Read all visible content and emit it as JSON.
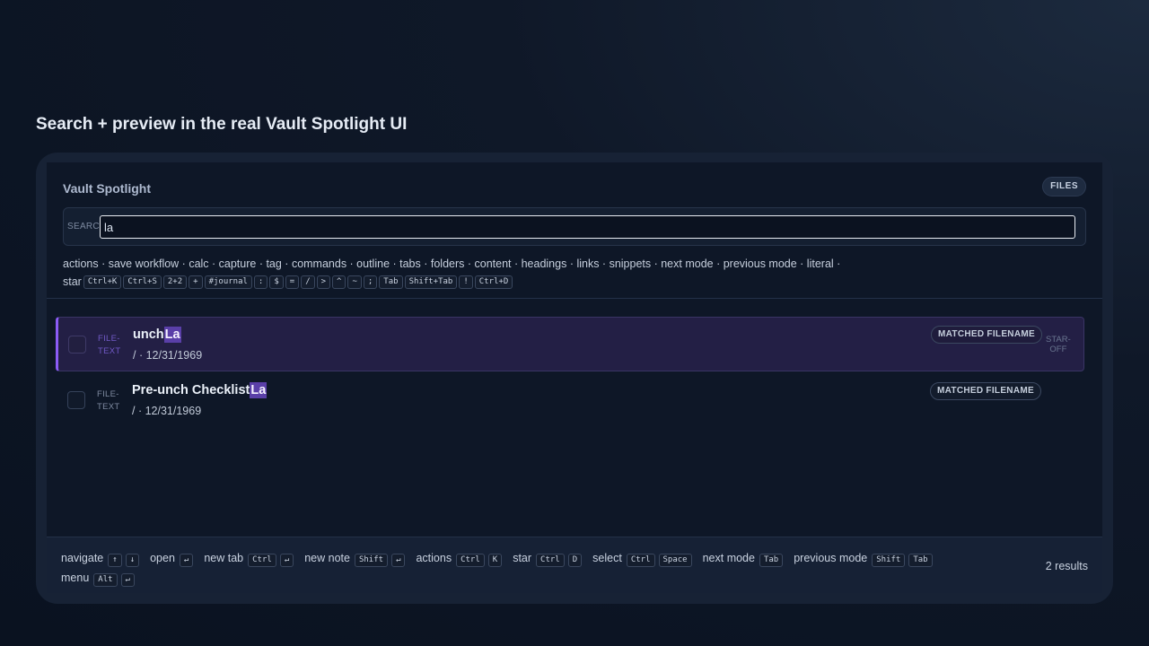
{
  "page": {
    "heading": "Search + preview in the real Vault Spotlight UI"
  },
  "header": {
    "title": "Vault Spotlight",
    "mode_badge": "FILES"
  },
  "search": {
    "label": "SEARCH",
    "value": "la",
    "placeholder": ""
  },
  "hints": {
    "line1": "actions · save workflow · calc · capture · tag · commands · outline · tabs · folders · content · headings · links · snippets · next mode · previous mode · literal ·",
    "line2_word": "star",
    "keys": [
      "Ctrl+K",
      "Ctrl+S",
      "2+2",
      "+",
      "#journal",
      ":",
      "$",
      "=",
      "/",
      ">",
      "^",
      "~",
      ";",
      "Tab",
      "Shift+Tab",
      "!",
      "Ctrl+D"
    ]
  },
  "results": [
    {
      "kind_line1": "FILE-",
      "kind_line2": "TEXT",
      "title_prefix": "unch",
      "title_match": "La",
      "meta": "/ · 12/31/1969",
      "badge": "MATCHED FILENAME",
      "star_line1": "STAR-",
      "star_line2": "OFF",
      "selected": true
    },
    {
      "kind_line1": "FILE-",
      "kind_line2": "TEXT",
      "title_prefix": "Pre-unch Checklist",
      "title_match": "La",
      "meta": "/ · 12/31/1969",
      "badge": "MATCHED FILENAME",
      "selected": false
    }
  ],
  "footer": {
    "shortcuts": [
      {
        "label": "navigate",
        "keys": [
          "↑",
          "↓"
        ]
      },
      {
        "label": "open",
        "keys": [
          "↵"
        ]
      },
      {
        "label": "new tab",
        "keys": [
          "Ctrl",
          "↵"
        ]
      },
      {
        "label": "new note",
        "keys": [
          "Shift",
          "↵"
        ]
      },
      {
        "label": "actions",
        "keys": [
          "Ctrl",
          "K"
        ]
      },
      {
        "label": "star",
        "keys": [
          "Ctrl",
          "D"
        ]
      },
      {
        "label": "select",
        "keys": [
          "Ctrl",
          "Space"
        ]
      },
      {
        "label": "next mode",
        "keys": [
          "Tab"
        ]
      },
      {
        "label": "previous mode",
        "keys": [
          "Shift",
          "Tab"
        ]
      },
      {
        "label": "menu",
        "keys": [
          "Alt",
          "↵"
        ]
      }
    ],
    "count": "2 results"
  },
  "colors": {
    "accent": "#8b5cf6",
    "highlight": "#5a3fa8",
    "background": "#0e1727"
  }
}
